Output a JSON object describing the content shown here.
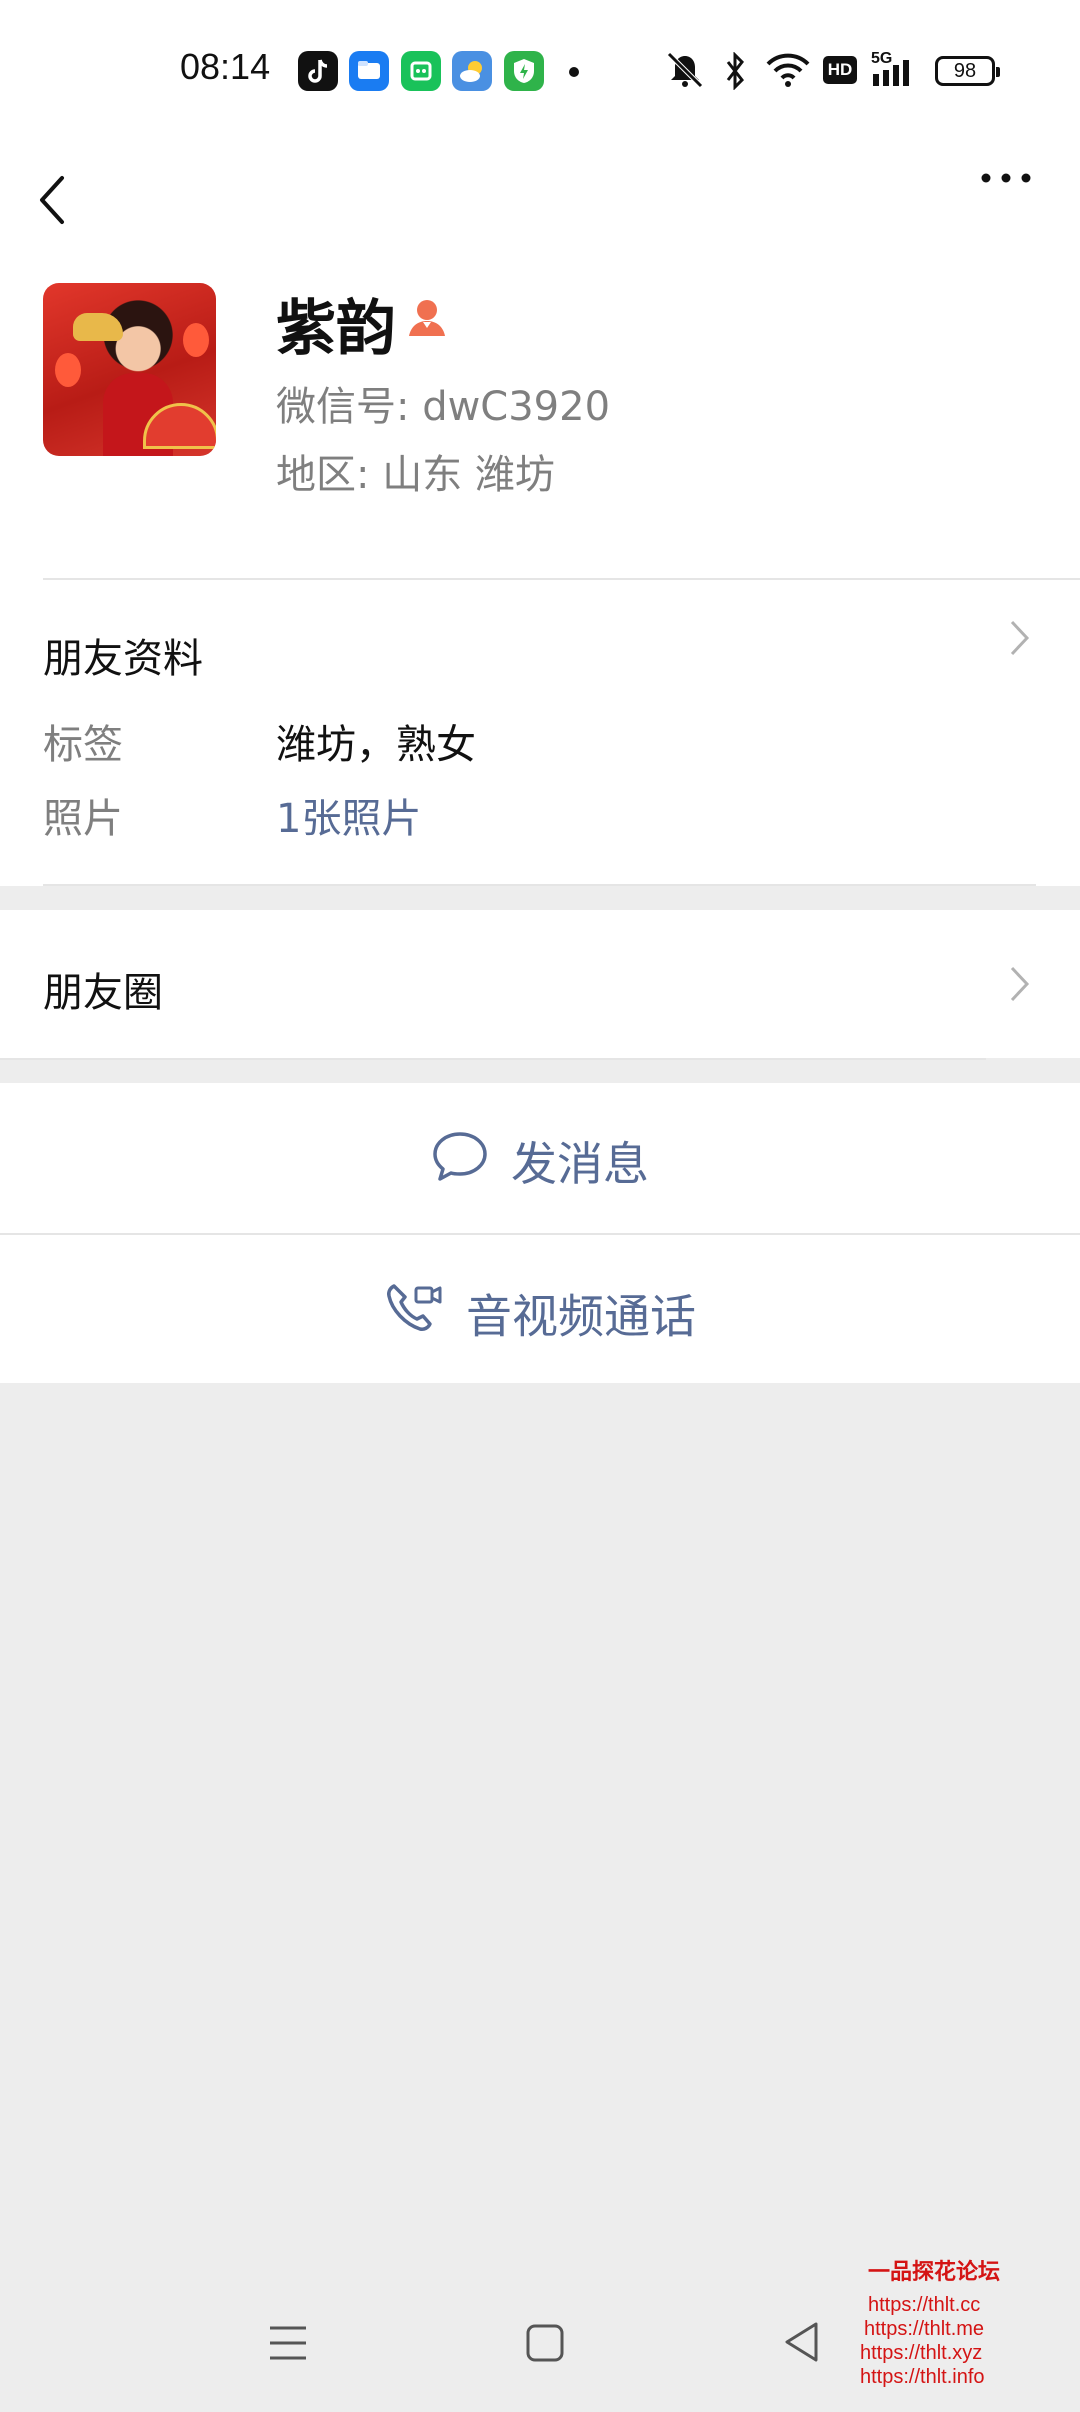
{
  "status_bar": {
    "time": "08:14",
    "network": "5G",
    "hd": "HD",
    "battery": "98"
  },
  "profile": {
    "name": "紫韵",
    "wechat_id": "微信号: dwC3920",
    "region": "地区: 山东  潍坊"
  },
  "friend_info": {
    "title": "朋友资料",
    "tags_label": "标签",
    "tags_value": "潍坊，熟女",
    "photos_label": "照片",
    "photos_value": "1张照片"
  },
  "moments": {
    "title": "朋友圈"
  },
  "actions": {
    "message": "发消息",
    "call": "音视频通话"
  },
  "watermark": {
    "title": "一品探花论坛",
    "lines": [
      "https://thlt.cc",
      "https://thlt.me",
      "https://thlt.xyz",
      "https://thlt.info"
    ]
  },
  "colors": {
    "link": "#576b95",
    "background": "#ededed",
    "badge": "#f07050"
  }
}
